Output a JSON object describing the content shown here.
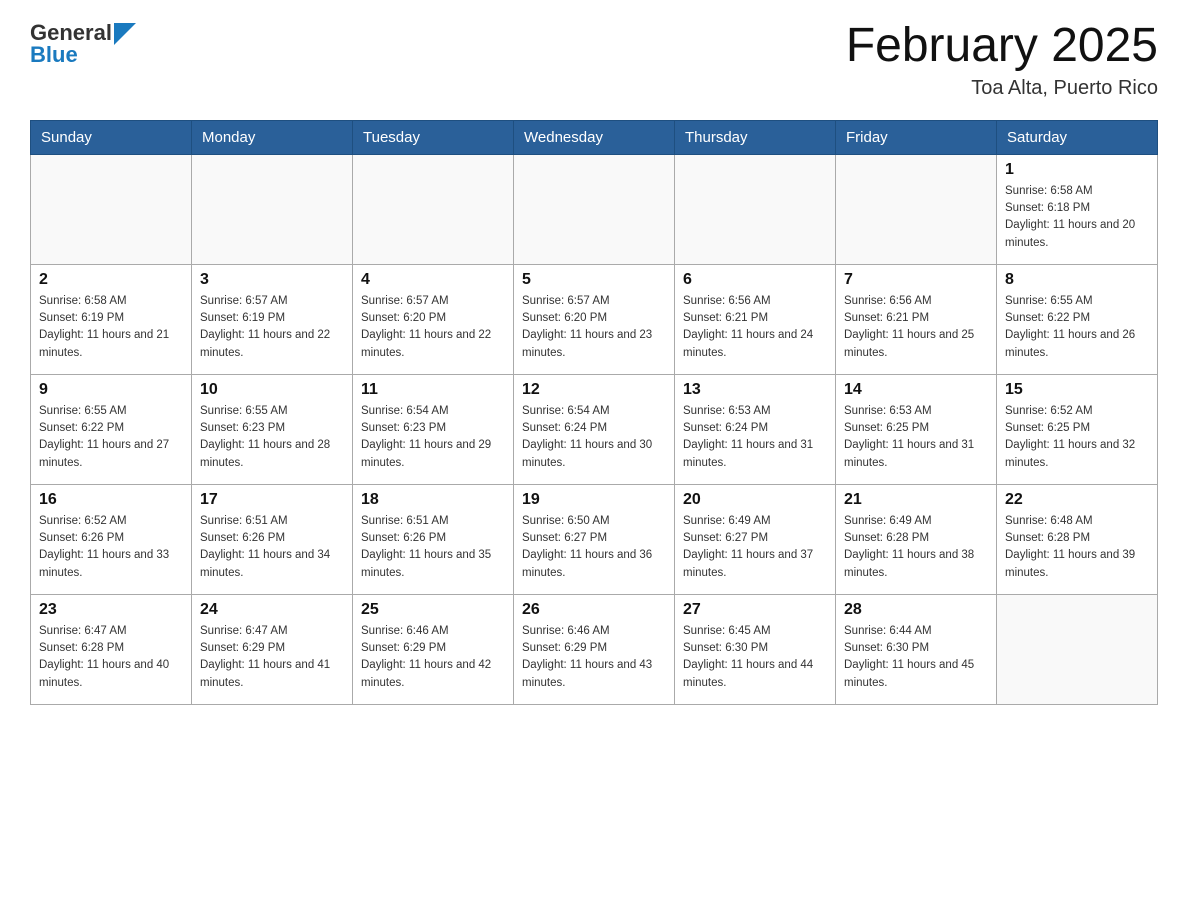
{
  "header": {
    "logo_general": "General",
    "logo_blue": "Blue",
    "month_title": "February 2025",
    "location": "Toa Alta, Puerto Rico"
  },
  "days_of_week": [
    "Sunday",
    "Monday",
    "Tuesday",
    "Wednesday",
    "Thursday",
    "Friday",
    "Saturday"
  ],
  "weeks": [
    [
      {
        "day": "",
        "sunrise": "",
        "sunset": "",
        "daylight": ""
      },
      {
        "day": "",
        "sunrise": "",
        "sunset": "",
        "daylight": ""
      },
      {
        "day": "",
        "sunrise": "",
        "sunset": "",
        "daylight": ""
      },
      {
        "day": "",
        "sunrise": "",
        "sunset": "",
        "daylight": ""
      },
      {
        "day": "",
        "sunrise": "",
        "sunset": "",
        "daylight": ""
      },
      {
        "day": "",
        "sunrise": "",
        "sunset": "",
        "daylight": ""
      },
      {
        "day": "1",
        "sunrise": "Sunrise: 6:58 AM",
        "sunset": "Sunset: 6:18 PM",
        "daylight": "Daylight: 11 hours and 20 minutes."
      }
    ],
    [
      {
        "day": "2",
        "sunrise": "Sunrise: 6:58 AM",
        "sunset": "Sunset: 6:19 PM",
        "daylight": "Daylight: 11 hours and 21 minutes."
      },
      {
        "day": "3",
        "sunrise": "Sunrise: 6:57 AM",
        "sunset": "Sunset: 6:19 PM",
        "daylight": "Daylight: 11 hours and 22 minutes."
      },
      {
        "day": "4",
        "sunrise": "Sunrise: 6:57 AM",
        "sunset": "Sunset: 6:20 PM",
        "daylight": "Daylight: 11 hours and 22 minutes."
      },
      {
        "day": "5",
        "sunrise": "Sunrise: 6:57 AM",
        "sunset": "Sunset: 6:20 PM",
        "daylight": "Daylight: 11 hours and 23 minutes."
      },
      {
        "day": "6",
        "sunrise": "Sunrise: 6:56 AM",
        "sunset": "Sunset: 6:21 PM",
        "daylight": "Daylight: 11 hours and 24 minutes."
      },
      {
        "day": "7",
        "sunrise": "Sunrise: 6:56 AM",
        "sunset": "Sunset: 6:21 PM",
        "daylight": "Daylight: 11 hours and 25 minutes."
      },
      {
        "day": "8",
        "sunrise": "Sunrise: 6:55 AM",
        "sunset": "Sunset: 6:22 PM",
        "daylight": "Daylight: 11 hours and 26 minutes."
      }
    ],
    [
      {
        "day": "9",
        "sunrise": "Sunrise: 6:55 AM",
        "sunset": "Sunset: 6:22 PM",
        "daylight": "Daylight: 11 hours and 27 minutes."
      },
      {
        "day": "10",
        "sunrise": "Sunrise: 6:55 AM",
        "sunset": "Sunset: 6:23 PM",
        "daylight": "Daylight: 11 hours and 28 minutes."
      },
      {
        "day": "11",
        "sunrise": "Sunrise: 6:54 AM",
        "sunset": "Sunset: 6:23 PM",
        "daylight": "Daylight: 11 hours and 29 minutes."
      },
      {
        "day": "12",
        "sunrise": "Sunrise: 6:54 AM",
        "sunset": "Sunset: 6:24 PM",
        "daylight": "Daylight: 11 hours and 30 minutes."
      },
      {
        "day": "13",
        "sunrise": "Sunrise: 6:53 AM",
        "sunset": "Sunset: 6:24 PM",
        "daylight": "Daylight: 11 hours and 31 minutes."
      },
      {
        "day": "14",
        "sunrise": "Sunrise: 6:53 AM",
        "sunset": "Sunset: 6:25 PM",
        "daylight": "Daylight: 11 hours and 31 minutes."
      },
      {
        "day": "15",
        "sunrise": "Sunrise: 6:52 AM",
        "sunset": "Sunset: 6:25 PM",
        "daylight": "Daylight: 11 hours and 32 minutes."
      }
    ],
    [
      {
        "day": "16",
        "sunrise": "Sunrise: 6:52 AM",
        "sunset": "Sunset: 6:26 PM",
        "daylight": "Daylight: 11 hours and 33 minutes."
      },
      {
        "day": "17",
        "sunrise": "Sunrise: 6:51 AM",
        "sunset": "Sunset: 6:26 PM",
        "daylight": "Daylight: 11 hours and 34 minutes."
      },
      {
        "day": "18",
        "sunrise": "Sunrise: 6:51 AM",
        "sunset": "Sunset: 6:26 PM",
        "daylight": "Daylight: 11 hours and 35 minutes."
      },
      {
        "day": "19",
        "sunrise": "Sunrise: 6:50 AM",
        "sunset": "Sunset: 6:27 PM",
        "daylight": "Daylight: 11 hours and 36 minutes."
      },
      {
        "day": "20",
        "sunrise": "Sunrise: 6:49 AM",
        "sunset": "Sunset: 6:27 PM",
        "daylight": "Daylight: 11 hours and 37 minutes."
      },
      {
        "day": "21",
        "sunrise": "Sunrise: 6:49 AM",
        "sunset": "Sunset: 6:28 PM",
        "daylight": "Daylight: 11 hours and 38 minutes."
      },
      {
        "day": "22",
        "sunrise": "Sunrise: 6:48 AM",
        "sunset": "Sunset: 6:28 PM",
        "daylight": "Daylight: 11 hours and 39 minutes."
      }
    ],
    [
      {
        "day": "23",
        "sunrise": "Sunrise: 6:47 AM",
        "sunset": "Sunset: 6:28 PM",
        "daylight": "Daylight: 11 hours and 40 minutes."
      },
      {
        "day": "24",
        "sunrise": "Sunrise: 6:47 AM",
        "sunset": "Sunset: 6:29 PM",
        "daylight": "Daylight: 11 hours and 41 minutes."
      },
      {
        "day": "25",
        "sunrise": "Sunrise: 6:46 AM",
        "sunset": "Sunset: 6:29 PM",
        "daylight": "Daylight: 11 hours and 42 minutes."
      },
      {
        "day": "26",
        "sunrise": "Sunrise: 6:46 AM",
        "sunset": "Sunset: 6:29 PM",
        "daylight": "Daylight: 11 hours and 43 minutes."
      },
      {
        "day": "27",
        "sunrise": "Sunrise: 6:45 AM",
        "sunset": "Sunset: 6:30 PM",
        "daylight": "Daylight: 11 hours and 44 minutes."
      },
      {
        "day": "28",
        "sunrise": "Sunrise: 6:44 AM",
        "sunset": "Sunset: 6:30 PM",
        "daylight": "Daylight: 11 hours and 45 minutes."
      },
      {
        "day": "",
        "sunrise": "",
        "sunset": "",
        "daylight": ""
      }
    ]
  ]
}
